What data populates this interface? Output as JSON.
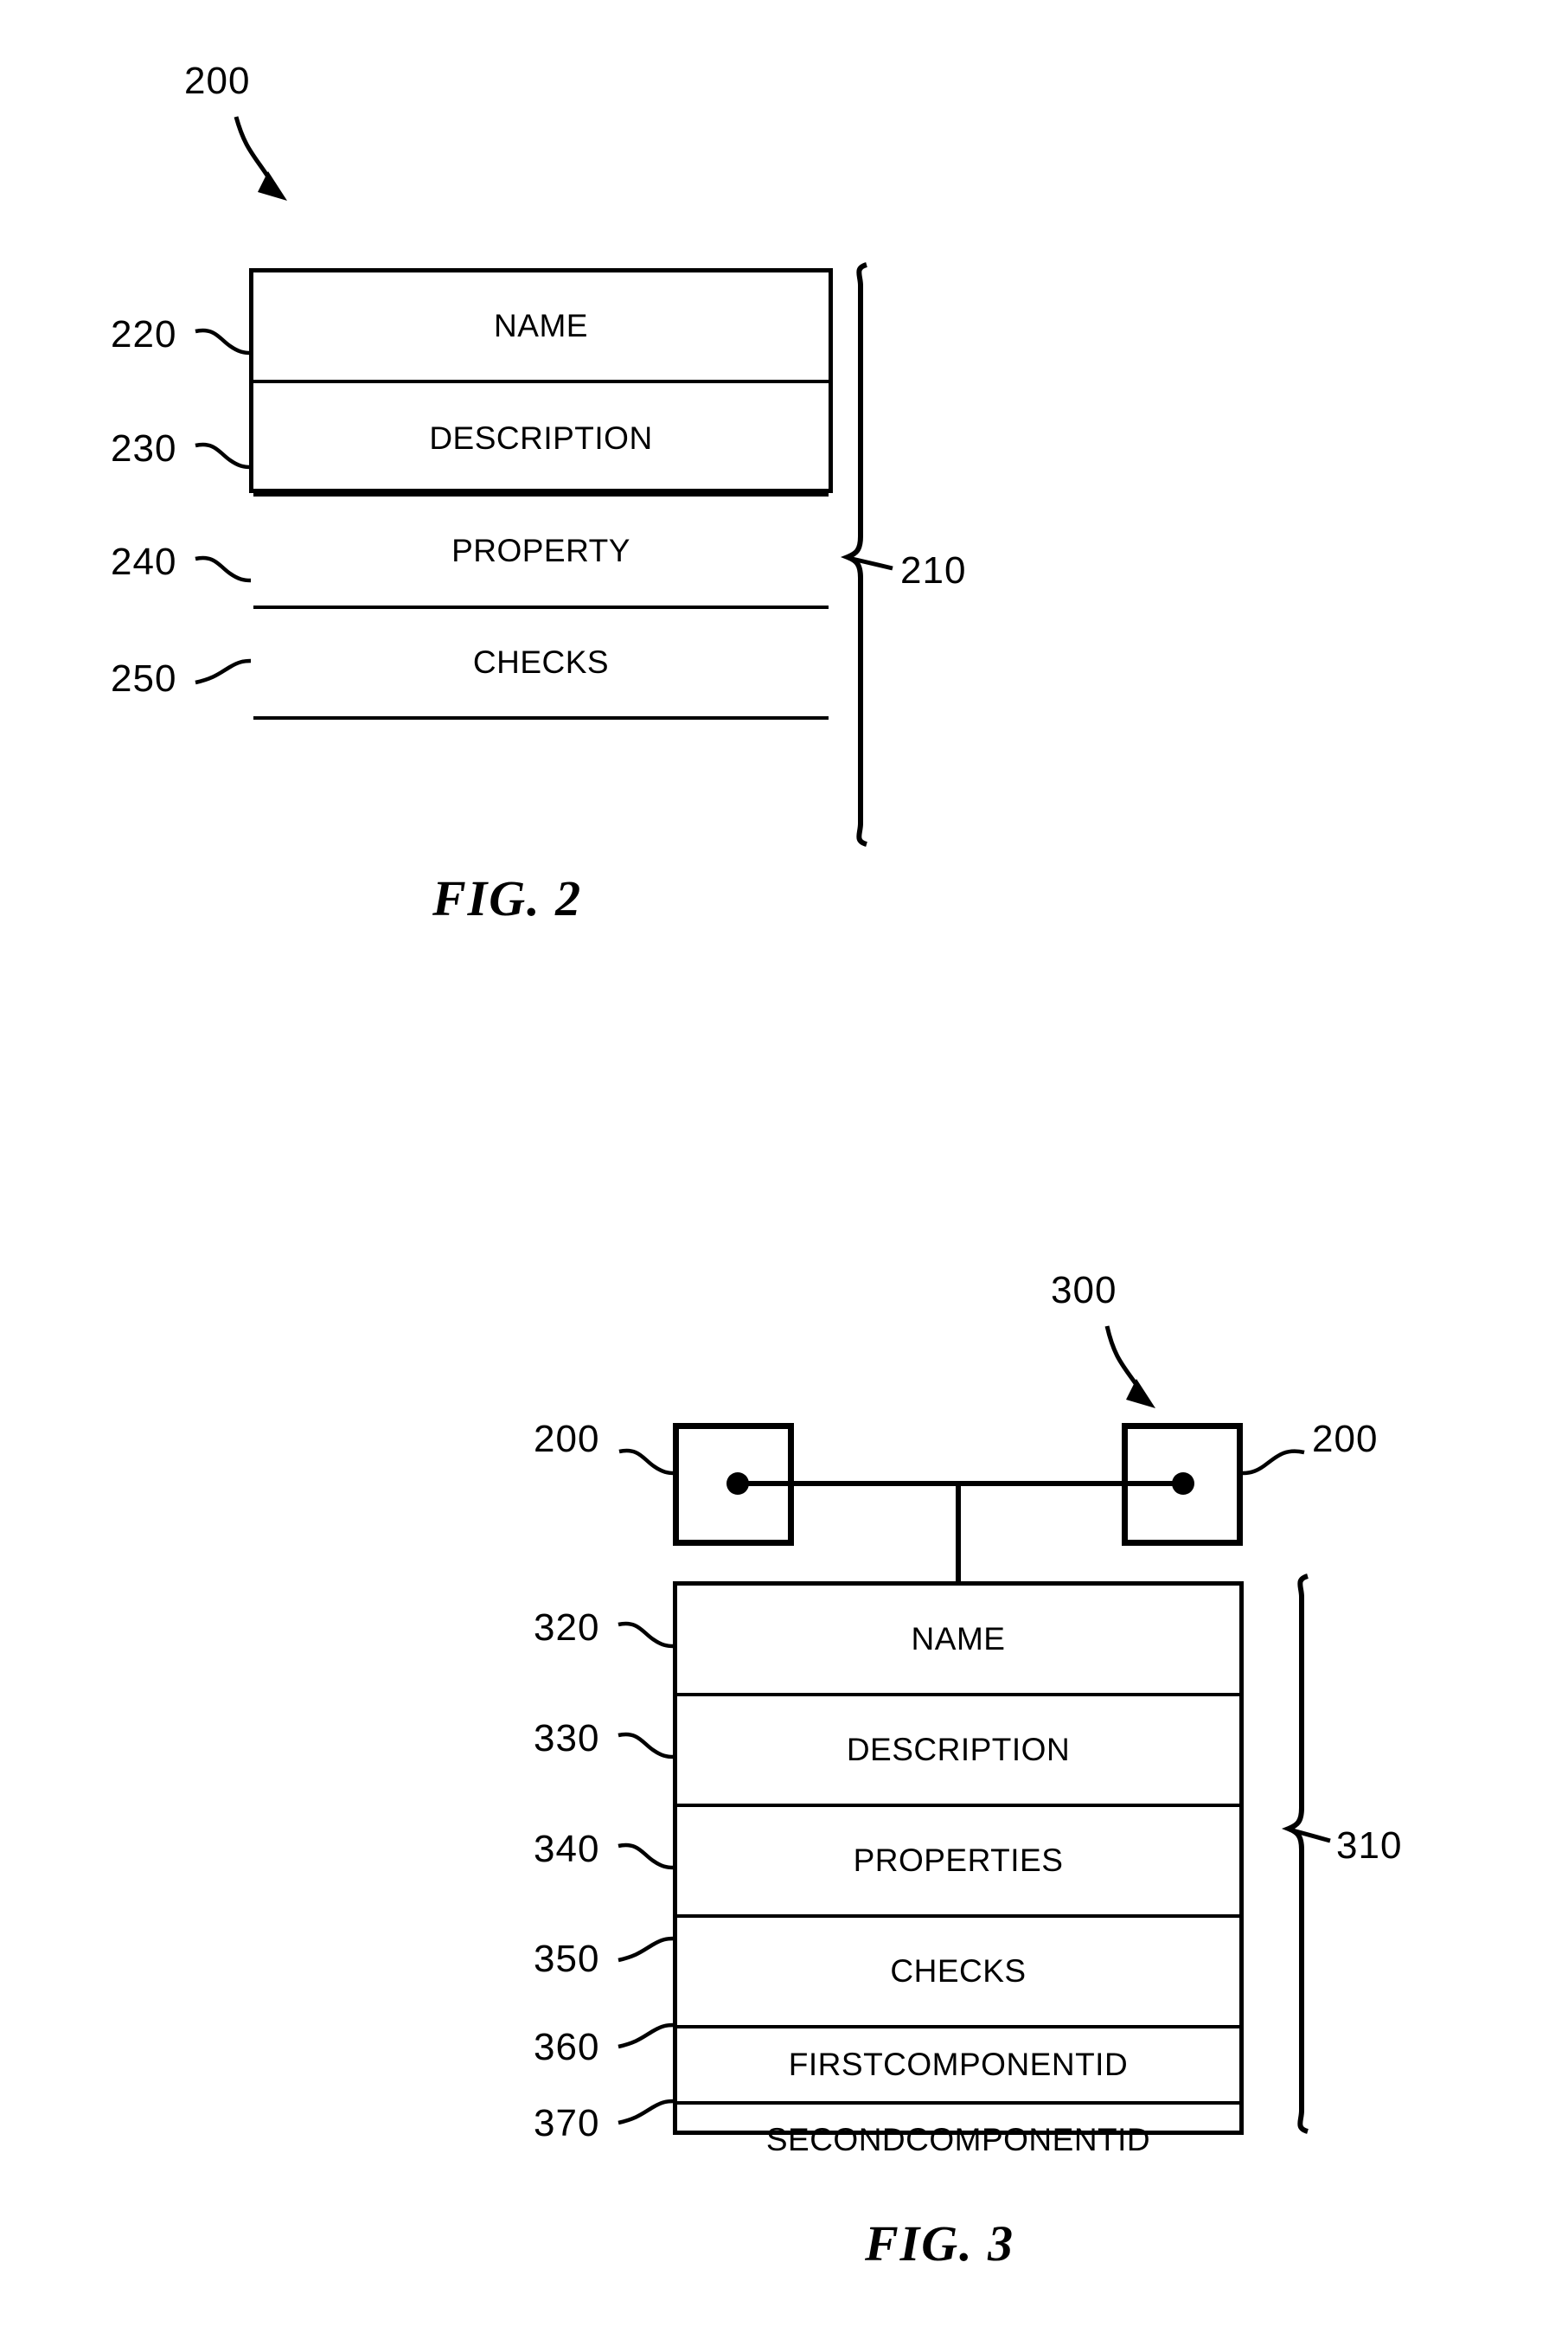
{
  "page": {
    "background": "#ffffff",
    "ink": "#000000"
  },
  "figures": [
    {
      "id": "fig2",
      "caption": "FIG. 2",
      "assembly_ref": "200",
      "bracket_ref": "210",
      "rows": [
        {
          "ref": "220",
          "label": "NAME"
        },
        {
          "ref": "230",
          "label": "DESCRIPTION"
        },
        {
          "ref": "240",
          "label": "PROPERTY"
        },
        {
          "ref": "250",
          "label": "CHECKS"
        },
        {
          "ref": "",
          "label": ""
        }
      ]
    },
    {
      "id": "fig3",
      "caption": "FIG. 3",
      "assembly_ref": "300",
      "bracket_ref": "310",
      "component_left_ref": "200",
      "component_right_ref": "200",
      "rows": [
        {
          "ref": "320",
          "label": "NAME"
        },
        {
          "ref": "330",
          "label": "DESCRIPTION"
        },
        {
          "ref": "340",
          "label": "PROPERTIES"
        },
        {
          "ref": "350",
          "label": "CHECKS"
        },
        {
          "ref": "360",
          "label": "FIRSTCOMPONENTID"
        },
        {
          "ref": "370",
          "label": "SECONDCOMPONENTID"
        }
      ]
    }
  ]
}
